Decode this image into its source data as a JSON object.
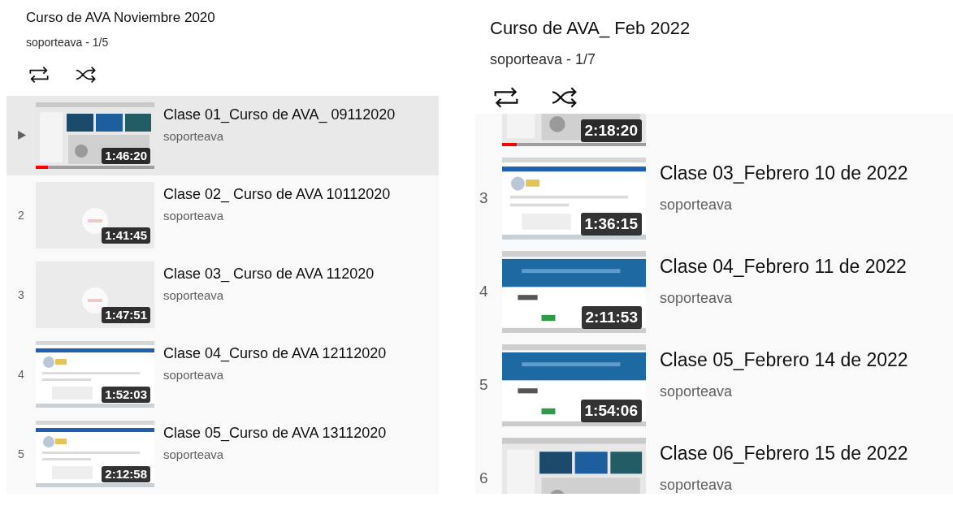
{
  "playlists": [
    {
      "title": "Curso de AVA Noviembre 2020",
      "byline": "soporteava - 1/5",
      "items": [
        {
          "selected": true,
          "title": "Clase 01_Curso de AVA_ 09112020",
          "channel": "soporteava",
          "duration": "1:46:20",
          "level": 0.1
        },
        {
          "selected": false,
          "index": "2",
          "title": "Clase 02_ Curso de AVA 10112020",
          "channel": "soporteava",
          "duration": "1:41:45"
        },
        {
          "selected": false,
          "index": "3",
          "title": "Clase 03_ Curso de AVA 112020",
          "channel": "soporteava",
          "duration": "1:47:51"
        },
        {
          "selected": false,
          "index": "4",
          "title": "Clase 04_Curso de AVA 12112020",
          "channel": "soporteava",
          "duration": "1:52:03"
        },
        {
          "selected": false,
          "index": "5",
          "title": "Clase 05_Curso de AVA 13112020",
          "channel": "soporteava",
          "duration": "2:12:58"
        }
      ]
    },
    {
      "title": "Curso de AVA_ Feb 2022",
      "byline": "soporteava - 1/7",
      "items": [
        {
          "selected": false,
          "duration": "2:18:20",
          "level": 0.1
        },
        {
          "selected": false,
          "index": "3",
          "title": "Clase 03_Febrero 10 de 2022",
          "channel": "soporteava",
          "duration": "1:36:15"
        },
        {
          "selected": false,
          "index": "4",
          "title": "Clase 04_Febrero 11 de 2022",
          "channel": "soporteava",
          "duration": "2:11:53"
        },
        {
          "selected": false,
          "index": "5",
          "title": "Clase 05_Febrero 14 de 2022",
          "channel": "soporteava",
          "duration": "1:54:06"
        },
        {
          "selected": false,
          "index": "6",
          "title": "Clase 06_Febrero 15 de 2022",
          "channel": "soporteava"
        }
      ]
    }
  ]
}
